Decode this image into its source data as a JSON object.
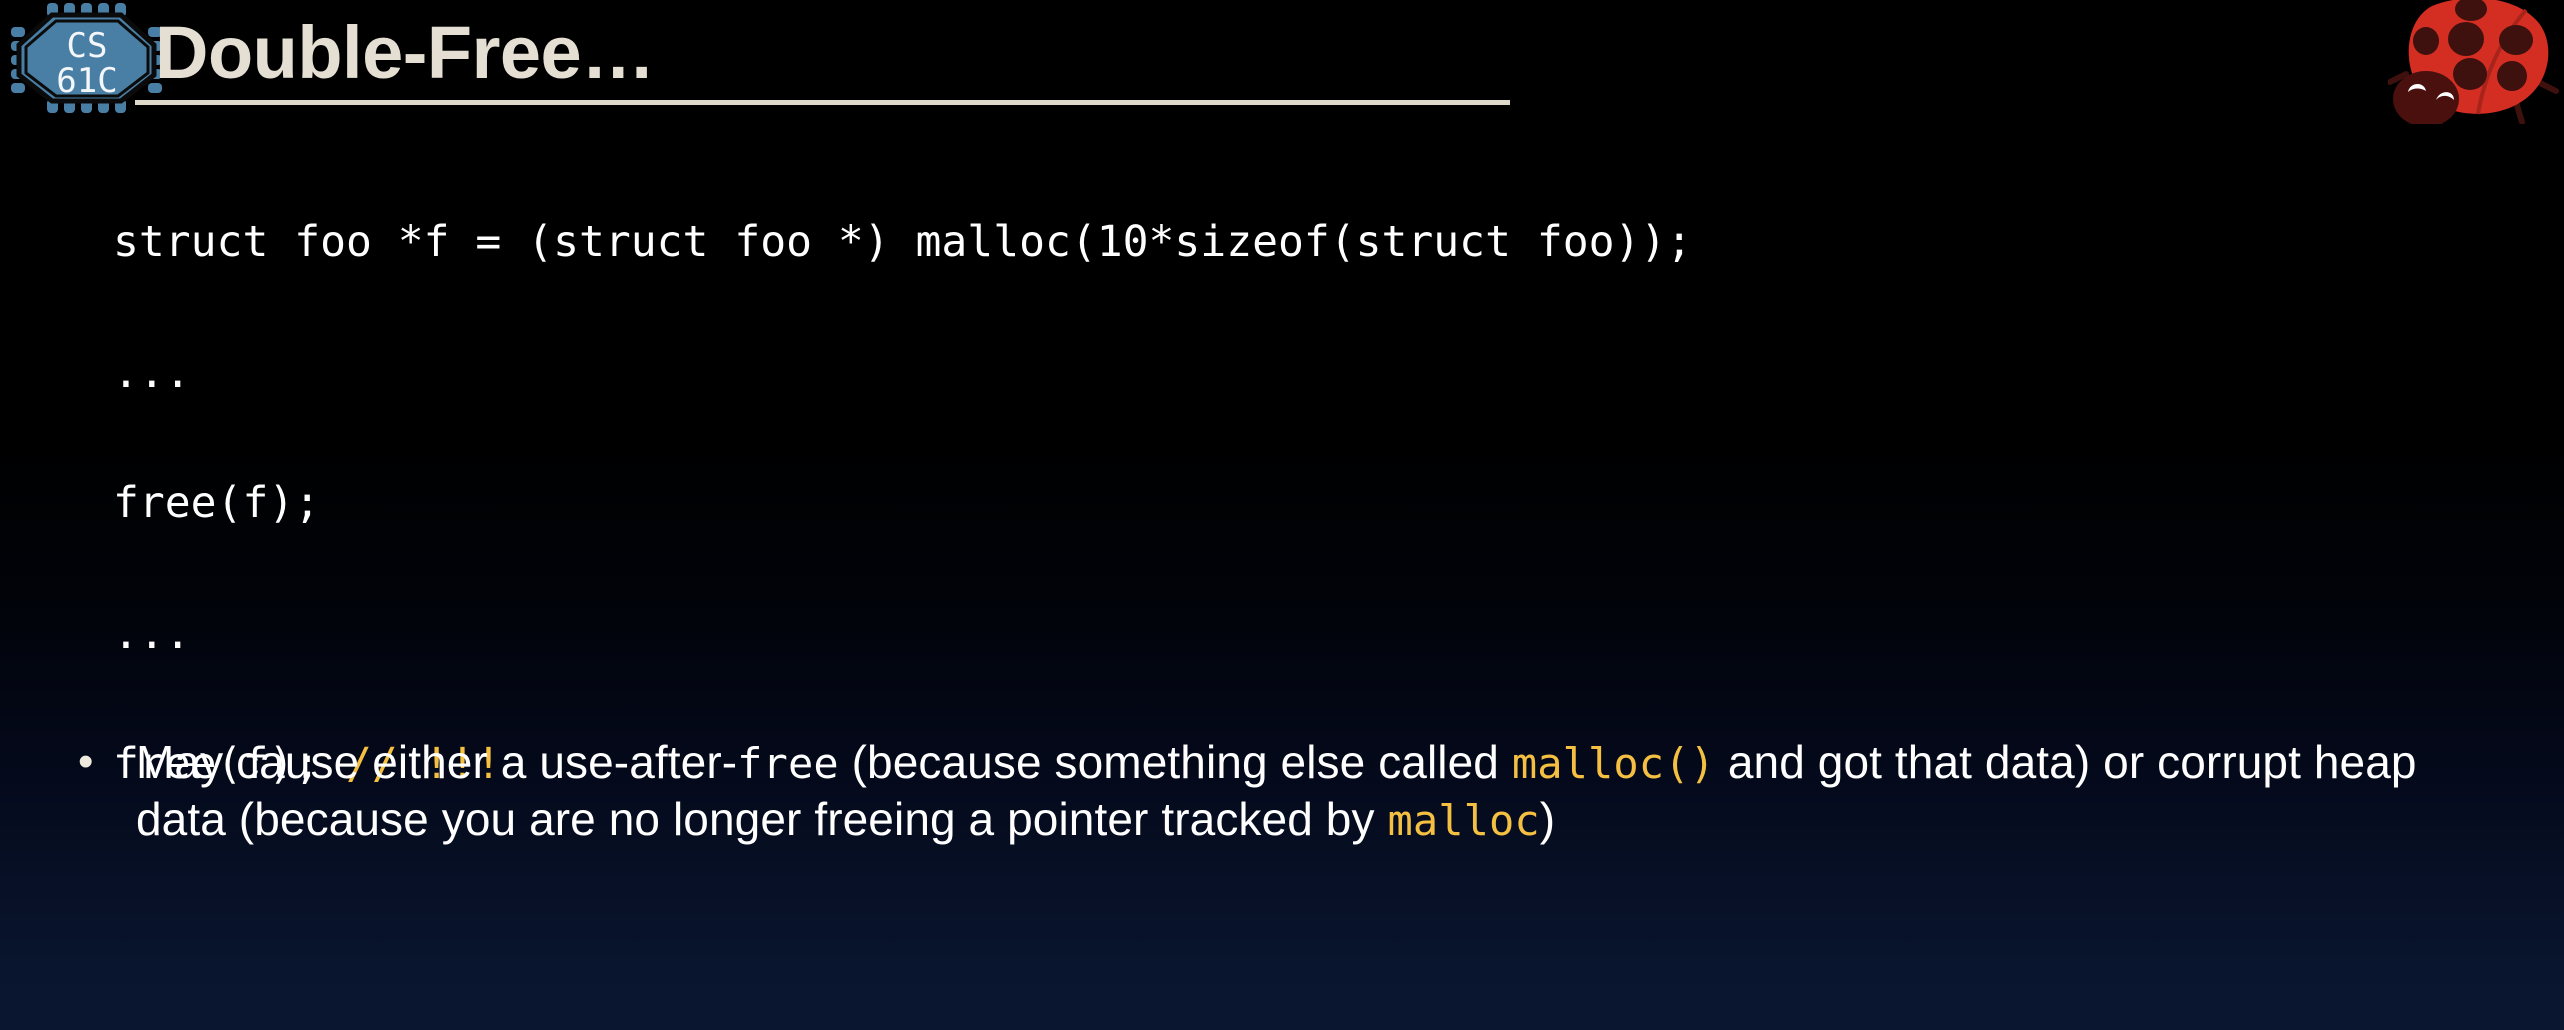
{
  "slide": {
    "title": "Double-Free…",
    "background_top_color": "#000000",
    "background_bottom_color": "#0a1630",
    "title_color": "#e4dfd2",
    "rule_color": "#ded9cb",
    "accent_gold": "#f5c042",
    "logo_blue": "#4a7fa5",
    "ladybug_red": "#d42e23",
    "ladybug_dark": "#3e100e"
  },
  "logo": {
    "line1": "CS",
    "line2": "61C",
    "alt": "cs61c-chip-logo"
  },
  "code": {
    "lines": [
      {
        "text": "struct foo *f = (struct foo *) malloc(10*sizeof(struct foo));",
        "comment": ""
      },
      {
        "text": "...",
        "comment": ""
      },
      {
        "text": "free(f);",
        "comment": ""
      },
      {
        "text": "...",
        "comment": ""
      },
      {
        "text": "free(f); ",
        "comment": "// !!!"
      }
    ]
  },
  "bullet": {
    "marker": "•",
    "segments": [
      {
        "text": "May cause either a use-after-",
        "style": "normal"
      },
      {
        "text": "free",
        "style": "mono"
      },
      {
        "text": " (because something else called ",
        "style": "normal"
      },
      {
        "text": "malloc()",
        "style": "mono-gold"
      },
      {
        "text": " and got that data) or corrupt heap data (because you are no longer freeing a pointer tracked by ",
        "style": "normal"
      },
      {
        "text": "malloc",
        "style": "mono-gold"
      },
      {
        "text": ")",
        "style": "normal"
      }
    ],
    "plain_text": "May cause either a use-after-free (because something else called malloc() and got that data) or corrupt heap data (because you are no longer freeing a pointer tracked by malloc)"
  }
}
